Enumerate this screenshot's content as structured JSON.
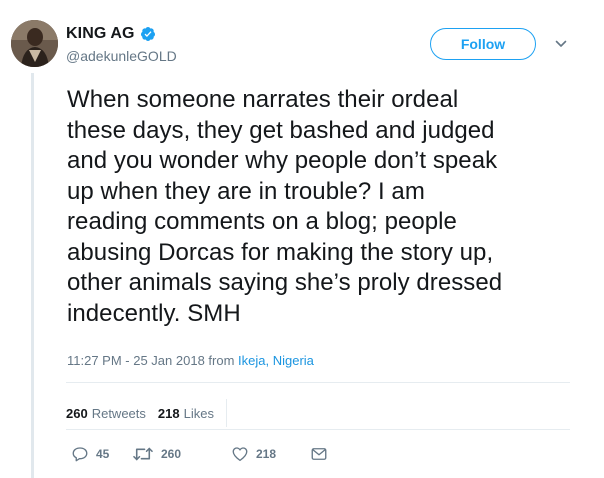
{
  "author": {
    "display_name": "KING AG",
    "handle": "@adekunleGOLD"
  },
  "follow_label": "Follow",
  "tweet": {
    "text": "When someone narrates their ordeal\nthese days, they get bashed and judged\nand you wonder why people don’t speak\nup when they are in trouble? I am\nreading comments on a blog; people\nabusing Dorcas for making the story up,\nother animals saying she’s proly dressed\nindecently. SMH",
    "timestamp": "11:27 PM - 25 Jan 2018",
    "from_label": "from",
    "location": "Ikeja, Nigeria"
  },
  "stats": {
    "retweets_count": "260",
    "retweets_label": "Retweets",
    "likes_count": "218",
    "likes_label": "Likes"
  },
  "actions": {
    "reply_count": "45",
    "retweet_count": "260",
    "like_count": "218"
  },
  "colors": {
    "accent": "#1da1f2",
    "link": "#1b95e0",
    "text": "#14171a",
    "muted": "#657786",
    "thread_line": "#e1e8ed"
  },
  "icons": {
    "verified": "verified-badge-icon",
    "caret": "chevron-down-icon",
    "reply": "reply-icon",
    "retweet": "retweet-icon",
    "like": "heart-icon",
    "message": "envelope-icon"
  }
}
